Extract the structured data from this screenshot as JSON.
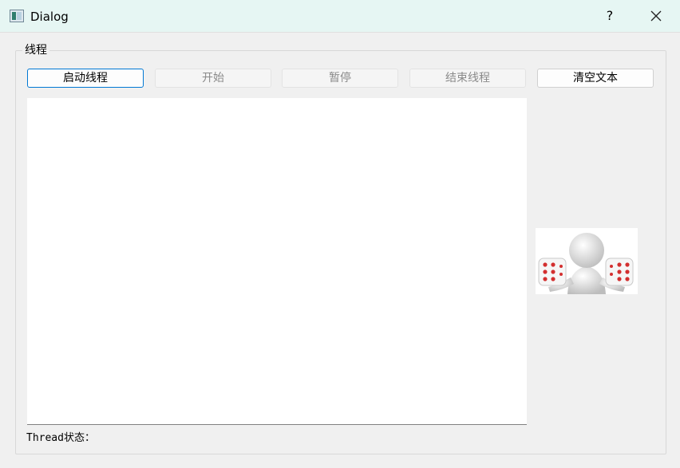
{
  "window": {
    "title": "Dialog",
    "help_label": "?",
    "close_icon": "close-icon",
    "app_icon": "window-app-icon"
  },
  "group": {
    "title": "线程"
  },
  "buttons": {
    "start_thread": "启动线程",
    "begin": "开始",
    "pause": "暂停",
    "stop_thread": "结束线程",
    "clear_text": "清空文本"
  },
  "text_area": {
    "value": ""
  },
  "status": {
    "label": "Thread状态："
  },
  "image": {
    "description_icon": "person-with-dice-image"
  },
  "colors": {
    "titlebar": "#e6f6f3",
    "window_bg": "#f0f0f0",
    "focus_border": "#0078d4",
    "dice_pip": "#d32f2f"
  }
}
